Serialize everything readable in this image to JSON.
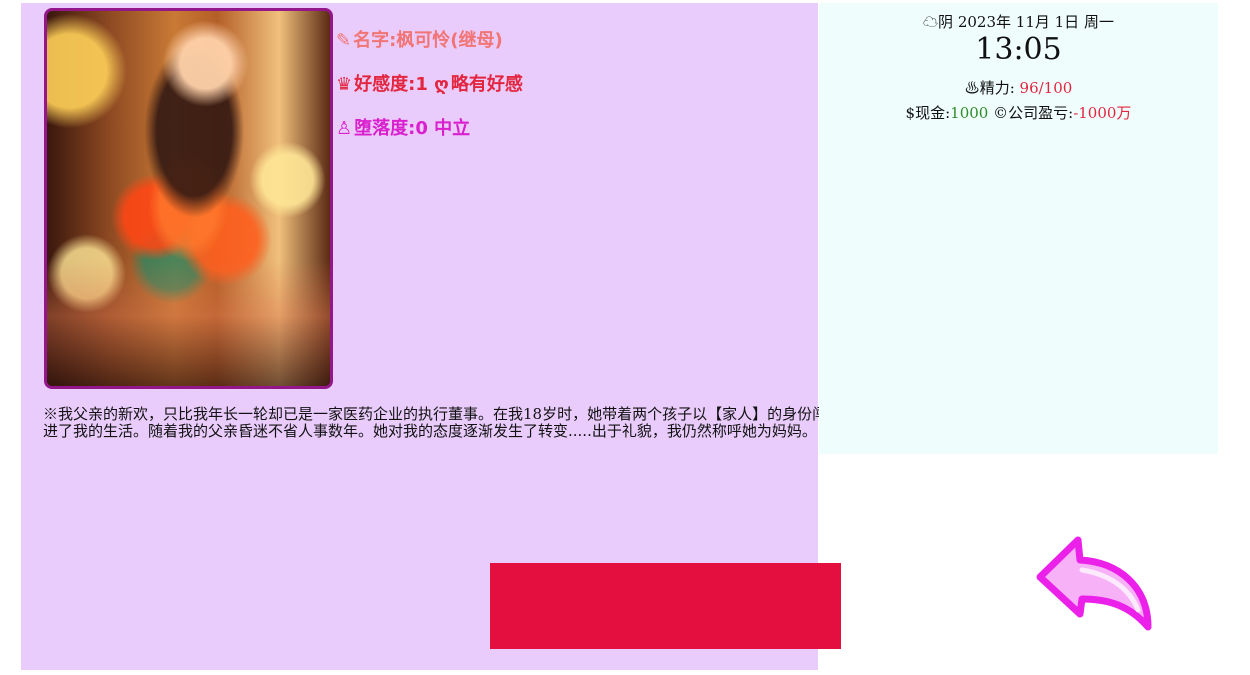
{
  "character": {
    "name_label": "名字:",
    "name": "枫可怜(继母)",
    "affection_label": "好感度:",
    "affection_value": "1",
    "affection_status": "略有好感",
    "corruption_label": "堕落度:",
    "corruption_value": "0",
    "corruption_status": "中立",
    "description": "※我父亲的新欢，只比我年长一轮却已是一家医药企业的执行董事。在我18岁时，她带着两个孩子以【家人】的身份闯进了我的生活。随着我的父亲昏迷不省人事数年。她对我的态度逐渐发生了转变.....出于礼貌，我仍然称呼她为妈妈。"
  },
  "status": {
    "weather": "阴",
    "date": "2023年 11月 1日 周一",
    "time": "13:05",
    "energy_label": "精力:",
    "energy_value": "96/100",
    "cash_label": "现金:",
    "cash_value": "1000",
    "company_label": "公司盈亏:",
    "company_value": "-1000万"
  },
  "icons": {
    "name": "pencil-icon",
    "affection": "crown-icon",
    "affection_status": "heart-ribbon-icon",
    "corruption": "rose-icon",
    "weather": "cloud-icon",
    "energy": "steam-icon",
    "cash": "dollar-icon",
    "company": "copyright-icon",
    "back": "back-arrow-icon"
  },
  "colors": {
    "left_panel": "#e9ccfb",
    "status_panel": "#f0fdfd",
    "name_text": "#f27474",
    "affection_text": "#e3263f",
    "corruption_text": "#da1fcf",
    "button": "#e50f3f",
    "back_arrow_fill": "#f7b1f7",
    "back_arrow_stroke": "#eb21ea"
  }
}
